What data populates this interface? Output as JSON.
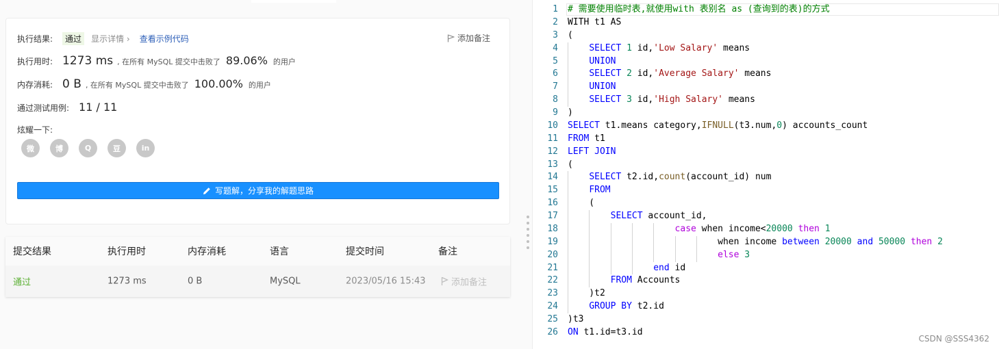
{
  "result": {
    "label": "执行结果:",
    "status": "通过",
    "details_link": "显示详情 ›",
    "view_code_link": "查看示例代码",
    "add_note": "添加备注"
  },
  "runtime": {
    "label": "执行用时:",
    "value": "1273 ms",
    "beat_text": ", 在所有 MySQL 提交中击败了",
    "percent": "89.06%",
    "suffix": "的用户"
  },
  "memory": {
    "label": "内存消耗:",
    "value": "0 B",
    "beat_text": ", 在所有 MySQL 提交中击败了",
    "percent": "100.00%",
    "suffix": "的用户"
  },
  "tests": {
    "label": "通过测试用例:",
    "value": "11 / 11"
  },
  "share": {
    "label": "炫耀一下:",
    "icons": [
      {
        "name": "wechat-icon",
        "glyph": "微"
      },
      {
        "name": "weibo-icon",
        "glyph": "博"
      },
      {
        "name": "qq-icon",
        "glyph": "Q"
      },
      {
        "name": "douban-icon",
        "glyph": "豆"
      },
      {
        "name": "linkedin-icon",
        "glyph": "in"
      }
    ]
  },
  "solution_button": "写题解，分享我的解题思路",
  "history": {
    "headers": [
      "提交结果",
      "执行用时",
      "内存消耗",
      "语言",
      "提交时间",
      "备注"
    ],
    "row": {
      "status": "通过",
      "runtime": "1273 ms",
      "memory": "0 B",
      "language": "MySQL",
      "time": "2023/05/16 15:43",
      "note": "添加备注"
    }
  },
  "editor": {
    "line_numbers": [
      "1",
      "2",
      "3",
      "4",
      "5",
      "6",
      "7",
      "8",
      "9",
      "10",
      "11",
      "12",
      "13",
      "14",
      "15",
      "16",
      "17",
      "18",
      "19",
      "20",
      "21",
      "22",
      "23",
      "24",
      "25",
      "26"
    ],
    "lines": [
      [
        [
          "cmt",
          "# 需要使用临时表,就使用with 表别名 as (查询到的表)的方式"
        ]
      ],
      [
        [
          "",
          "WITH t1 AS"
        ]
      ],
      [
        [
          "",
          "("
        ]
      ],
      [
        [
          "",
          "    "
        ],
        [
          "kw",
          "SELECT"
        ],
        [
          "num",
          " 1"
        ],
        [
          "",
          " id,"
        ],
        [
          "str",
          "'Low Salary'"
        ],
        [
          "",
          " means"
        ]
      ],
      [
        [
          "",
          "    "
        ],
        [
          "kw",
          "UNION"
        ]
      ],
      [
        [
          "",
          "    "
        ],
        [
          "kw",
          "SELECT"
        ],
        [
          "num",
          " 2"
        ],
        [
          "",
          " id,"
        ],
        [
          "str",
          "'Average Salary'"
        ],
        [
          "",
          " means"
        ]
      ],
      [
        [
          "",
          "    "
        ],
        [
          "kw",
          "UNION"
        ]
      ],
      [
        [
          "",
          "    "
        ],
        [
          "kw",
          "SELECT"
        ],
        [
          "num",
          " 3"
        ],
        [
          "",
          " id,"
        ],
        [
          "str",
          "'High Salary'"
        ],
        [
          "",
          " means"
        ]
      ],
      [
        [
          "",
          ")"
        ]
      ],
      [
        [
          "kw",
          "SELECT"
        ],
        [
          "",
          " t1.means category,"
        ],
        [
          "fn",
          "IFNULL"
        ],
        [
          "",
          "(t3.num,"
        ],
        [
          "num",
          "0"
        ],
        [
          "",
          ") accounts_count"
        ]
      ],
      [
        [
          "kw",
          "FROM"
        ],
        [
          "",
          " t1"
        ]
      ],
      [
        [
          "kw",
          "LEFT JOIN"
        ]
      ],
      [
        [
          "",
          "("
        ]
      ],
      [
        [
          "",
          "    "
        ],
        [
          "kw",
          "SELECT"
        ],
        [
          "",
          " t2.id,"
        ],
        [
          "fn",
          "count"
        ],
        [
          "",
          "(account_id) num"
        ]
      ],
      [
        [
          "",
          "    "
        ],
        [
          "kw",
          "FROM"
        ]
      ],
      [
        [
          "",
          "    ("
        ]
      ],
      [
        [
          "",
          "        "
        ],
        [
          "kw",
          "SELECT"
        ],
        [
          "",
          " account_id,"
        ]
      ],
      [
        [
          "",
          "                    "
        ],
        [
          "ctl",
          "case"
        ],
        [
          "",
          " when income<"
        ],
        [
          "num",
          "20000"
        ],
        [
          "",
          " "
        ],
        [
          "ctl",
          "then"
        ],
        [
          "num",
          " 1"
        ]
      ],
      [
        [
          "",
          "                            when income "
        ],
        [
          "kw",
          "between"
        ],
        [
          "num",
          " 20000"
        ],
        [
          "",
          " "
        ],
        [
          "kw",
          "and"
        ],
        [
          "num",
          " 50000"
        ],
        [
          "",
          " "
        ],
        [
          "ctl",
          "then"
        ],
        [
          "num",
          " 2"
        ]
      ],
      [
        [
          "",
          "                            "
        ],
        [
          "ctl",
          "else"
        ],
        [
          "num",
          " 3"
        ]
      ],
      [
        [
          "",
          "                "
        ],
        [
          "kw",
          "end"
        ],
        [
          "",
          " id"
        ]
      ],
      [
        [
          "",
          "        "
        ],
        [
          "kw",
          "FROM"
        ],
        [
          "",
          " Accounts"
        ]
      ],
      [
        [
          "",
          "    )t2"
        ]
      ],
      [
        [
          "",
          "    "
        ],
        [
          "kw",
          "GROUP BY"
        ],
        [
          "",
          " t2.id"
        ]
      ],
      [
        [
          "",
          ")t3"
        ]
      ],
      [
        [
          "kw",
          "ON"
        ],
        [
          "",
          " t1.id=t3.id"
        ]
      ]
    ]
  },
  "watermark": "CSDN @SSS4362",
  "colors": {
    "accent": "#1890ff",
    "pass_green": "#5cb034",
    "keyword": "#0000ff",
    "string": "#a31515",
    "number": "#098658",
    "comment": "#008000"
  }
}
